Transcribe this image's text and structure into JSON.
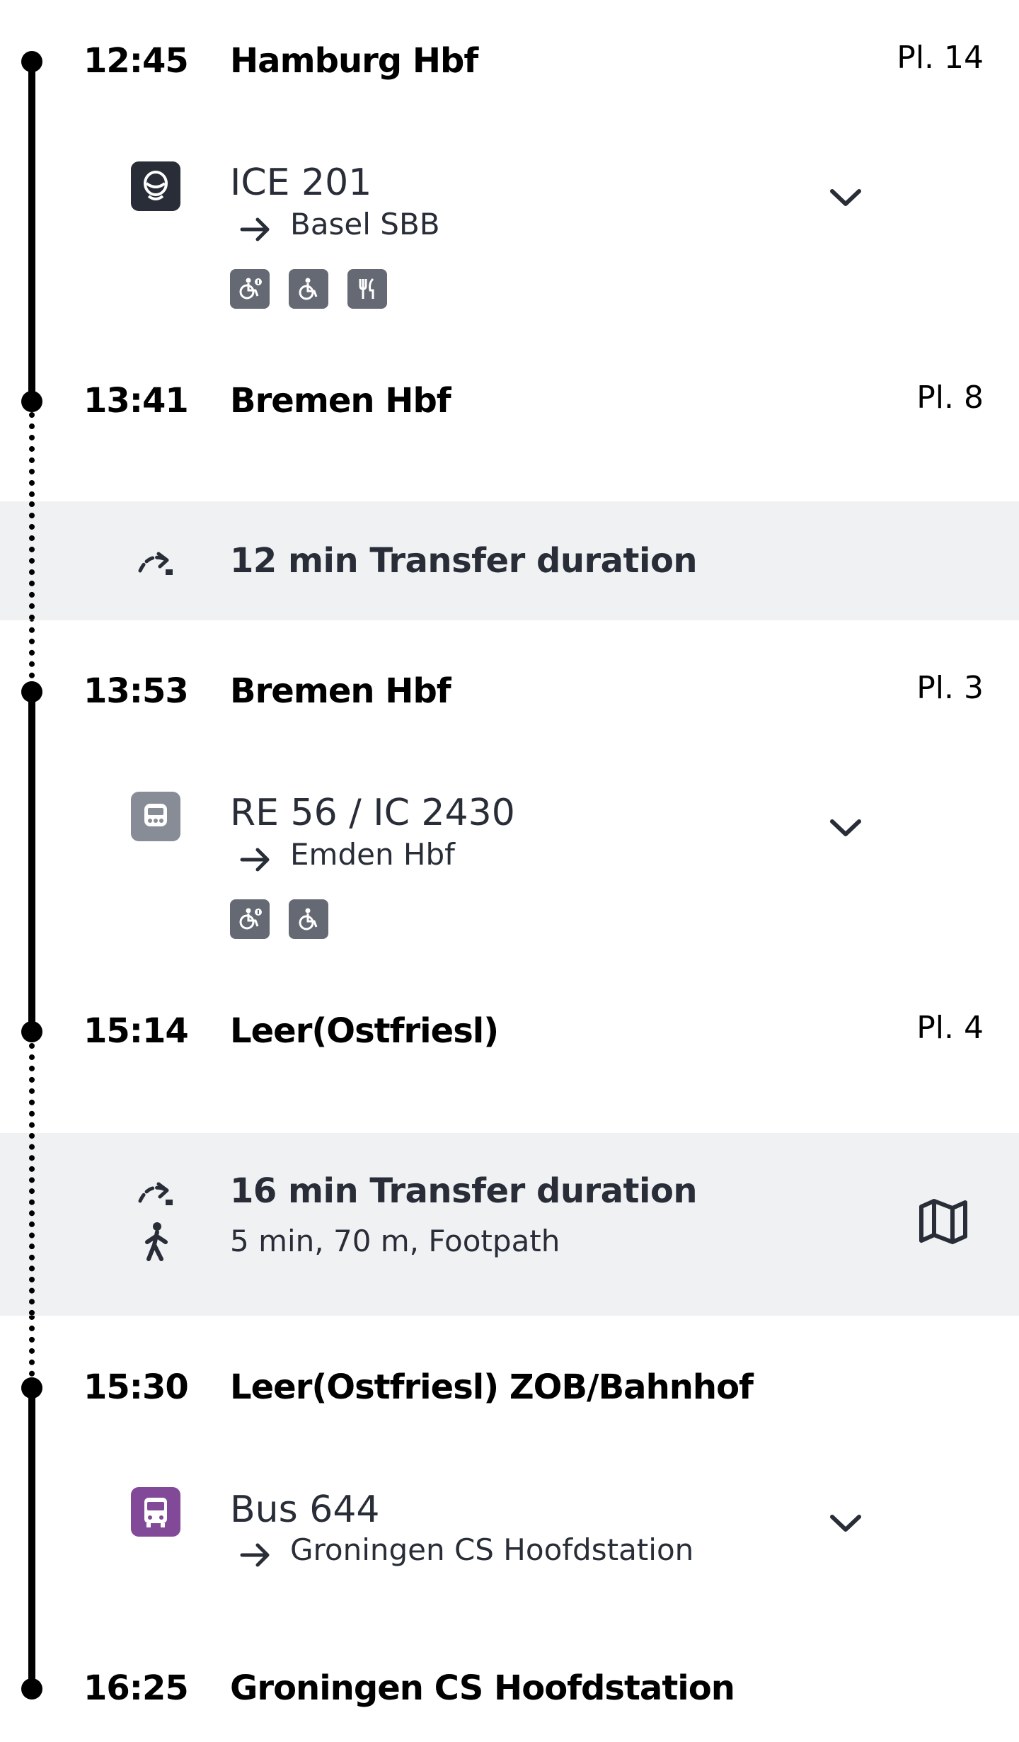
{
  "stops": [
    {
      "time": "12:45",
      "station": "Hamburg Hbf",
      "platform": "Pl. 14"
    },
    {
      "time": "13:41",
      "station": "Bremen Hbf",
      "platform": "Pl. 8"
    },
    {
      "time": "13:53",
      "station": "Bremen Hbf",
      "platform": "Pl. 3"
    },
    {
      "time": "15:14",
      "station": "Leer(Ostfriesl)",
      "platform": "Pl. 4"
    },
    {
      "time": "15:30",
      "station": "Leer(Ostfriesl) ZOB/Bahnhof",
      "platform": ""
    },
    {
      "time": "16:25",
      "station": "Groningen CS Hoofdstation",
      "platform": ""
    }
  ],
  "legs": [
    {
      "name": "ICE 201",
      "destination": "Basel SBB",
      "product_icon": "ice-train-icon",
      "amenities": [
        "wheelchair-info-icon",
        "bicycle-icon",
        "restaurant-icon"
      ],
      "icon_color": "#282d37"
    },
    {
      "name": "RE 56 / IC 2430",
      "destination": "Emden Hbf",
      "product_icon": "regional-train-icon",
      "amenities": [
        "wheelchair-info-icon",
        "bicycle-icon"
      ],
      "icon_color": "#878c96"
    },
    {
      "name": "Bus 644",
      "destination": "Groningen CS Hoofdstation",
      "product_icon": "bus-icon",
      "amenities": [],
      "icon_color": "#814997"
    }
  ],
  "transfers": [
    {
      "title": "12 min Transfer duration",
      "subtitle": ""
    },
    {
      "title": "16 min Transfer duration",
      "subtitle": "5 min, 70 m, Footpath"
    }
  ],
  "colors": {
    "line": "#000000",
    "transfer_bg": "#f0f1f3",
    "text": "#282d37",
    "amenity_bg": "#646973"
  }
}
